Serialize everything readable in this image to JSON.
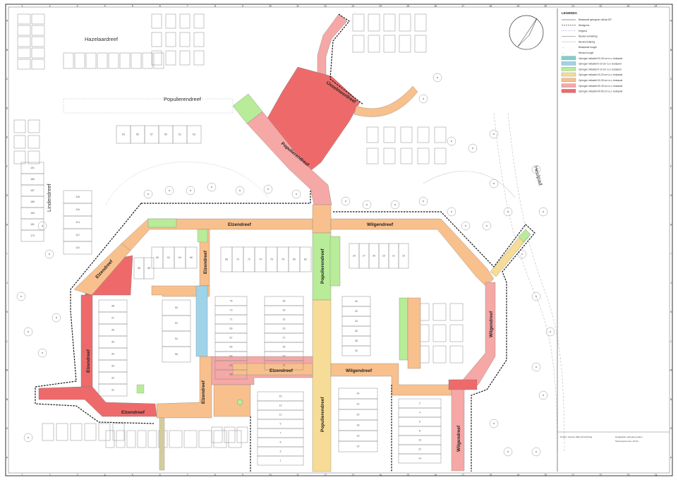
{
  "legend": {
    "title": "LEGENDA",
    "items": [
      {
        "label": "Bestaande gebogene zuilhoe 80*",
        "swatch": "line",
        "color": "#666666"
      },
      {
        "label": "Werkgrens",
        "swatch": "dashline",
        "color": "#222222"
      },
      {
        "label": "Erfgrens",
        "swatch": "dotline",
        "color": "#8aa0c8"
      },
      {
        "label": "Nieuwe verharding",
        "swatch": "line",
        "color": "#999999"
      },
      {
        "label": "Nieuwe belijning",
        "swatch": "line",
        "color": "#bbbbbb"
      },
      {
        "label": "Bestaande hoogte",
        "swatch": "text",
        "color": "#666666"
      },
      {
        "label": "Nieuwe hoogte",
        "swatch": "text",
        "color": "#666666"
      },
      {
        "label": "Ophogen indicatief 20-30 cm t.o.v. bestaand",
        "swatch": "fill",
        "color": "#7fd0cc"
      },
      {
        "label": "Ophogen indicatief 0-10 cm t.o.v. bestaand",
        "swatch": "fill",
        "color": "#9fd3e8"
      },
      {
        "label": "Ophogen indicatief 0-10 cm t.o.v. bestaand",
        "swatch": "fill",
        "color": "#b8ec98"
      },
      {
        "label": "Ophogen indicatief 10-20 cm t.o.v. bestaand",
        "swatch": "fill",
        "color": "#f6dc96"
      },
      {
        "label": "Ophogen indicatief 20-30 cm t.o.v. bestaand",
        "swatch": "fill",
        "color": "#f8c08c"
      },
      {
        "label": "Ophogen indicatief 30-40 cm t.o.v. bestaand",
        "swatch": "fill",
        "color": "#f5a8a6"
      },
      {
        "label": "Ophogen indicatief 40-50 cm t.o.v. bestaand",
        "swatch": "fill",
        "color": "#ee6a6a"
      }
    ]
  },
  "streets": {
    "hazelaardreef": "Hazelaardreef",
    "populierendreef_west": "Populierendreef",
    "ijsselmeer": "IJsselmeerdreef",
    "populierendreef_diag": "Populierendreef",
    "populierendreef_mid": "Populierendreef",
    "populierendreef_south": "Populierendreef",
    "elzendreef_north": "Elzendreef",
    "elzendreef_v1": "Elzendreef",
    "elzendreef_nw": "Elzendreef",
    "elzendreef_west": "Elzendreef",
    "elzendreef_sw": "Elzendreef",
    "elzendreef_v2": "Elzendreef",
    "elzendreef_mid": "Elzendreef",
    "wilgendreef_north": "Wilgendreef",
    "wilgendreef_east": "Wilgendreef",
    "wilgendreef_mid": "Wilgendreef",
    "wilgendreef_se": "Wilgendreef",
    "lindendreef": "Lindendreef",
    "heulpad": "Heulpad"
  },
  "house_numbers": {
    "block_a": [
      "38",
      "37",
      "36",
      "35",
      "34",
      "33",
      "32",
      "31"
    ],
    "block_b": [
      "68",
      "70",
      "72",
      "74",
      "76",
      "78",
      "80",
      "82"
    ],
    "block_c": [
      "60",
      "62",
      "64",
      "66"
    ],
    "block_d": [
      "56",
      "58"
    ],
    "block_e": [
      "50",
      "52",
      "54",
      "56"
    ],
    "block_f": [
      "75",
      "73",
      "71",
      "69",
      "67",
      "65",
      "63",
      "61",
      "59"
    ],
    "block_g": [
      "29",
      "27",
      "25",
      "23",
      "21",
      "19"
    ],
    "block_h": [
      "30",
      "32",
      "34",
      "36",
      "38",
      "40"
    ],
    "block_i": [
      "35",
      "33",
      "31",
      "29",
      "27",
      "25",
      "23",
      "21"
    ],
    "block_j": [
      "15",
      "13",
      "11",
      "9",
      "7",
      "5",
      "3",
      "1"
    ],
    "block_k": [
      "2",
      "4",
      "6",
      "8",
      "10",
      "12",
      "14"
    ],
    "block_l": [
      "24",
      "22",
      "20",
      "18",
      "16",
      "14"
    ],
    "block_m": [
      "191",
      "189",
      "187",
      "185",
      "183",
      "181",
      "179"
    ],
    "block_n": [
      "118",
      "116",
      "114",
      "112",
      "110"
    ],
    "block_o": [
      "53",
      "55",
      "57",
      "59",
      "61",
      "63"
    ]
  },
  "frame": {
    "top_numbers": [
      "1",
      "2",
      "3",
      "4",
      "5",
      "6",
      "7",
      "8",
      "9",
      "10",
      "11",
      "12",
      "13",
      "14",
      "15",
      "16",
      "17",
      "18",
      "19",
      "20",
      "21",
      "22",
      "23",
      "24"
    ],
    "side_letters": [
      "A",
      "B",
      "C",
      "D",
      "E",
      "F",
      "G",
      "H",
      "I",
      "J",
      "K",
      "L",
      "M",
      "N",
      "O",
      "P"
    ]
  },
  "title_block": {
    "line1": "Project: Kolonie Wijk Herinrichting",
    "line2": "Hoogteplan ophoging straten",
    "line3": "Tekeningnummer: HT-01"
  },
  "colors": {
    "c50": "#ee6a6a",
    "c40": "#f5a8a6",
    "c30": "#f8c08c",
    "c20": "#f6dc96",
    "green": "#b8ec98",
    "blue": "#9fd3e8",
    "teal": "#7fd0cc"
  }
}
